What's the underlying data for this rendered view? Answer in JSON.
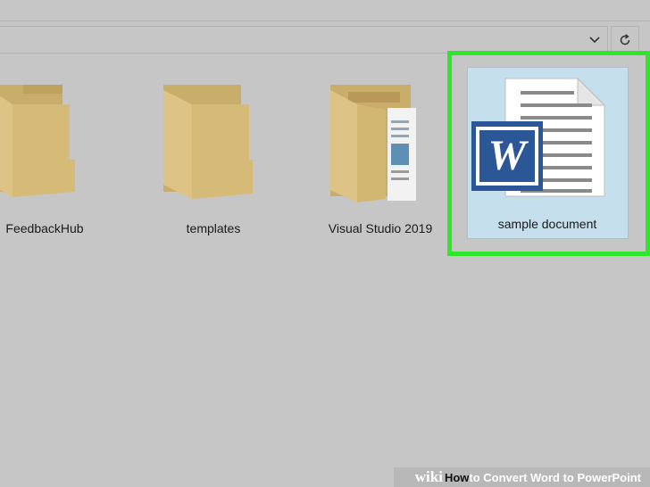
{
  "address_bar": {
    "dropdown_icon": "chevron-down-icon",
    "refresh_icon": "refresh-icon"
  },
  "folders": [
    {
      "name": "FeedbackHub"
    },
    {
      "name": "templates"
    },
    {
      "name": "Visual Studio 2019"
    }
  ],
  "selected_file": {
    "name": "sample document",
    "icon": "word-document-icon"
  },
  "colors": {
    "selection_outline": "#2fe62a",
    "selection_fill": "#c5dfed",
    "word_blue": "#2b5797",
    "folder": "#d8be7c"
  },
  "watermark": {
    "brand": "wiki",
    "how": "How",
    "title": " to Convert Word to PowerPoint"
  }
}
